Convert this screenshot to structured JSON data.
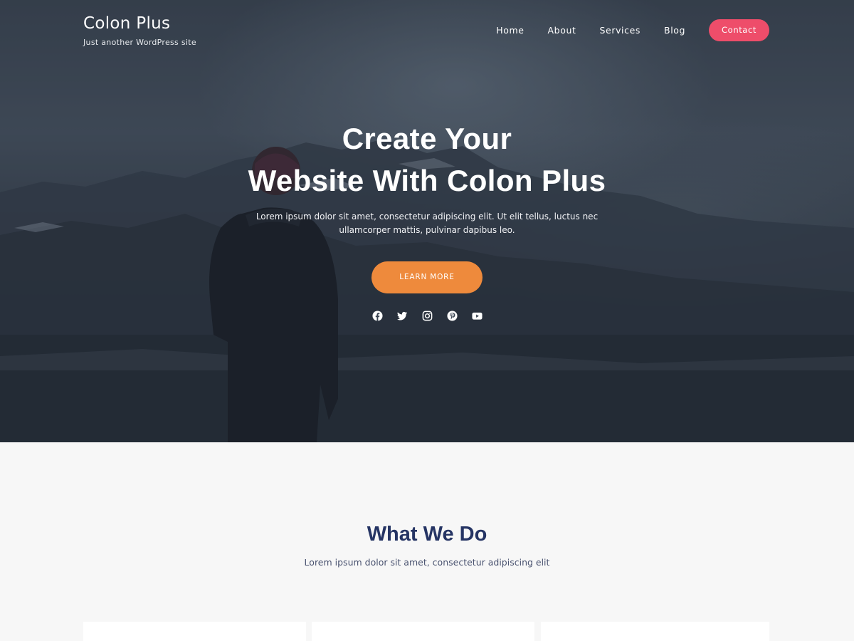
{
  "site": {
    "title": "Colon Plus",
    "tagline": "Just another WordPress site"
  },
  "nav": {
    "items": [
      {
        "label": "Home"
      },
      {
        "label": "About"
      },
      {
        "label": "Services"
      },
      {
        "label": "Blog"
      }
    ],
    "contact_label": "Contact"
  },
  "hero": {
    "title_line1": "Create Your",
    "title_line2": "Website With Colon Plus",
    "text": "Lorem ipsum dolor sit amet, consectetur adipiscing elit. Ut elit tellus, luctus nec ullamcorper mattis, pulvinar dapibus leo.",
    "button_label": "LEARN MORE",
    "social_icons": [
      "facebook-icon",
      "twitter-icon",
      "instagram-icon",
      "pinterest-icon",
      "youtube-icon"
    ]
  },
  "services": {
    "title": "What We Do",
    "subtitle": "Lorem ipsum dolor sit amet, consectetur adipiscing elit"
  },
  "colors": {
    "contact_button": "#ee4d6a",
    "hero_button": "#ee8a3c",
    "heading": "#253464",
    "section_bg": "#f7f7f7"
  }
}
